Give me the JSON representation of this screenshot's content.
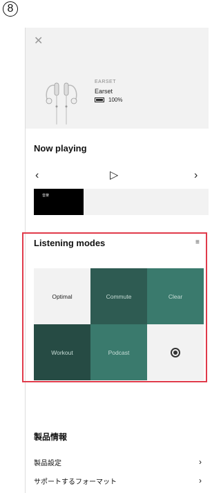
{
  "step_badge": "8",
  "header": {
    "close_glyph": "✕"
  },
  "product": {
    "brand": "EARSET",
    "name": "Earset",
    "battery": "100%"
  },
  "now_playing": {
    "title": "Now playing",
    "prev_glyph": "‹",
    "play_glyph": "▷",
    "next_glyph": "›",
    "track_text": "音楽"
  },
  "listening_modes": {
    "title": "Listening modes",
    "menu_glyph": "≡",
    "tiles": [
      {
        "label": "Optimal",
        "style": "light"
      },
      {
        "label": "Commute",
        "style": "dark1"
      },
      {
        "label": "Clear",
        "style": "dark2"
      },
      {
        "label": "Workout",
        "style": "dark3"
      },
      {
        "label": "Podcast",
        "style": "dark2"
      }
    ]
  },
  "product_info": {
    "title": "製品情報",
    "items": [
      {
        "label": "製品設定",
        "chevron": "›"
      },
      {
        "label": "サポートするフォーマット",
        "chevron": "›"
      }
    ]
  },
  "colors": {
    "highlight": "#e03a4a",
    "tile_dark": "#2e5b52",
    "tile_mid": "#3a7a6d",
    "tile_light": "#f2f2f2"
  },
  "icons": [
    "close-icon",
    "battery-icon",
    "prev-icon",
    "play-icon",
    "next-icon",
    "menu-icon",
    "target-icon",
    "chevron-right-icon"
  ]
}
